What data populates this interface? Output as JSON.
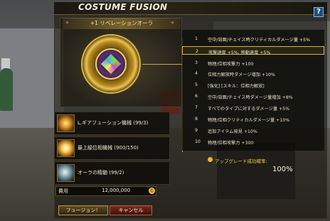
{
  "window": {
    "title": "COSTUME FUSION",
    "help": "?"
  },
  "item": {
    "name": "+1 リベレーションオーラ"
  },
  "materials": [
    {
      "label": "L.ギアフューション機械 (99/3)",
      "icon": "glow-orb-icon"
    },
    {
      "label": "最上級位相機械 (900/150)",
      "icon": "light-burst-icon"
    },
    {
      "label": "オーラの精髄 (99/2)",
      "icon": "crystal-orb-icon"
    }
  ],
  "fee": {
    "label": "費用",
    "value": "12,000,000",
    "coin": "C"
  },
  "buttons": {
    "fuse": "フュージョン！",
    "cancel": "キャンセル"
  },
  "stats": [
    {
      "n": "1",
      "text": "空中/背面/チェイス時クリティカルダメージ量 +5%"
    },
    {
      "n": "2",
      "text": "攻撃速度 +5%, 移動速度 +5%"
    },
    {
      "n": "3",
      "text": "物理/位相攻撃力 +100"
    },
    {
      "n": "4",
      "text": "位相力解放時ダメージ増加 +10%"
    },
    {
      "n": "5",
      "text": "[強化] [スキル：位相力解放]"
    },
    {
      "n": "6",
      "text": "空中/背面/チェイス時ダメージ量増加 +8%"
    },
    {
      "n": "7",
      "text": "すべてのタイプに対するダメージ量 +5%"
    },
    {
      "n": "8",
      "text": "物理/位相クリティカルダメージ量 +10%"
    },
    {
      "n": "9",
      "text": "追加アイテム発見 +10%"
    },
    {
      "n": "10",
      "text": "物理/位相攻撃力 +300"
    }
  ],
  "upgrade": {
    "label": "アップグレード成功確率:",
    "value": "100%"
  },
  "colors": {
    "accent": "#d9b24a",
    "highlight": "#fff0b0",
    "rate": "#f3c448",
    "cancel": "#7a2a1c"
  }
}
